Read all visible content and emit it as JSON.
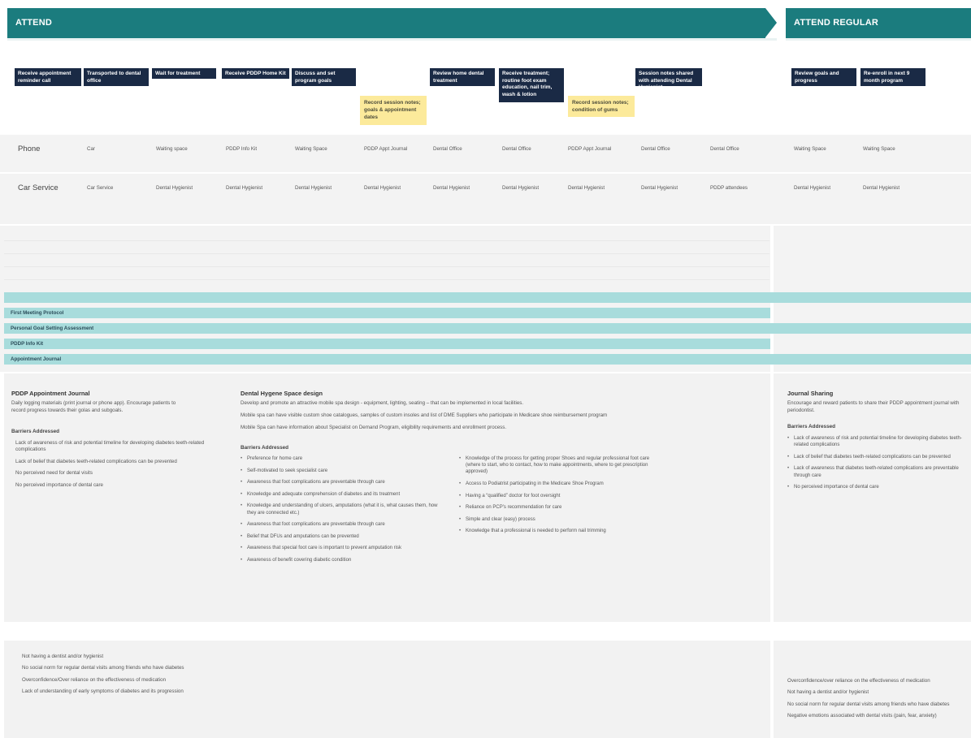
{
  "stages": [
    {
      "label": "ATTEND"
    },
    {
      "label": "ATTEND REGULAR"
    }
  ],
  "steps": [
    "Receive appointment reminder call",
    "Transported to dental office",
    "Wait for treatment",
    "Receive PDDP Home Kit",
    "Discuss and set program goals",
    "Review home dental treatment",
    "Receive treatment; routine foot exam education, nail trim, wash & lotion",
    "Session notes shared with attending Dental Hygienist",
    "Review goals and progress",
    "Re-enroll in next 9 month program"
  ],
  "notes": [
    "Record session notes; goals & appointment dates",
    "Record session notes; condition of gums"
  ],
  "lanes": {
    "phone": {
      "title": "Phone",
      "cells": [
        "Car",
        "Waiting space",
        "PDDP Info Kit",
        "Waiting Space",
        "PDDP Appt Journal",
        "Dental Office",
        "Dental Office",
        "PDDP Appt Journal",
        "Dental Office",
        "Dental Office",
        "Waiting Space",
        "Waiting Space"
      ]
    },
    "car": {
      "title": "Car Service",
      "cells": [
        "Car Service",
        "Dental Hygienist",
        "Dental Hygienist",
        "Dental Hygienist",
        "Dental Hygienist",
        "Dental Hygienist",
        "Dental Hygienist",
        "Dental Hygienist",
        "Dental Hygienist",
        "PDDP attendees",
        "Dental Hygienist",
        "Dental Hygienist"
      ]
    }
  },
  "bars": [
    "First Meeting Protocol",
    "Personal Goal Setting Assessment",
    "PDDP Info Kit",
    "Appointment Journal"
  ],
  "panel_journal": {
    "title": "PDDP Appointment Journal",
    "desc": "Daily logging materials (print journal or phone app). Encourage patients to record progress towards their golas and subgoals.",
    "barriers_title": "Barriers Addressed",
    "barriers": [
      "Lack of awareness of risk and potential timeline for developing diabetes teeth-related complications",
      "Lack of belief that diabetes teeth-related complications can be prevented",
      "No perceived need for dental visits",
      "No perceived importance of dental care"
    ]
  },
  "panel_spa": {
    "title": "Dental Hygene Space design",
    "lines": [
      "Develop and promote an attractive mobile spa design - equipment, lighting, seating – that can be implemented in local facilities.",
      "Mobile spa can have visible custom shoe catalogues, samples of custom insoles and list of DME Suppliers who participate in Medicare shoe reimbursement program",
      "Mobile Spa can have information about Specialist on Demand Program,  eligibility requirements and enrollment process."
    ],
    "barriers_title": "Barriers Addressed",
    "barriers_left": [
      "Preference for home care",
      "Self-motivated to seek specialist care",
      "Awareness that foot complications are preventable through care",
      "Knowledge and adequate comprehension of diabetes and its treatment",
      "Knowledge and understanding of ulcers, amputations (what it is, what causes them, how they are connected etc.)",
      "Awareness that foot complications are preventable through care",
      "Belief that DFUs and amputations can be prevented",
      "Awareness that special foot care is important to prevent amputation risk",
      "Awareness of benefit covering diabetic condition"
    ],
    "barriers_right": [
      "Knowledge of the process for getting proper Shoes and regular professional foot care (where to start, who to contact, how to make appointments, where to get prescription approved)",
      "Access to Podiatrist participating in the Medicare Shoe Program",
      "Having a “qualified” doctor for foot oversight",
      "Reliance on PCP’s recommendation for care",
      "Simple and clear (easy) process",
      "Knowledge that a professional is needed to perform nail trimming"
    ]
  },
  "panel_sharing": {
    "title": "Journal Sharing",
    "desc": "Encourage and reward patients to share their PDDP appointment journal with periodontist.",
    "barriers_title": "Barriers Addressed",
    "barriers": [
      "Lack of awareness of risk and potential timeline for developing diabetes teeth-related complications",
      "Lack of belief that diabetes teeth-related complications can be prevented",
      "Lack of awareness that diabetes teeth-related complications are preventable through care",
      "No perceived importance of dental care"
    ]
  },
  "bottom_left": [
    "Not having a dentist and/or hygienist",
    "No social norm for regular dental visits among friends who have diabetes",
    "Overconfidence/Over reliance on the effectiveness of medication",
    "Lack of understanding of early symptoms of diabetes and its progression"
  ],
  "bottom_right": [
    "Overconfidence/over reliance on the effectiveness of medication",
    "Not having a dentist and/or hygienist",
    "No social norm for regular dental visits among friends who have diabetes",
    "Negative emotions associated with dental visits (pain, fear, anxiety)"
  ],
  "colors": {
    "stage": "#1b7c7e",
    "step": "#1a2a45",
    "note": "#fcea9b",
    "bar": "#a8dcdc",
    "panel": "#f2f2f2"
  }
}
